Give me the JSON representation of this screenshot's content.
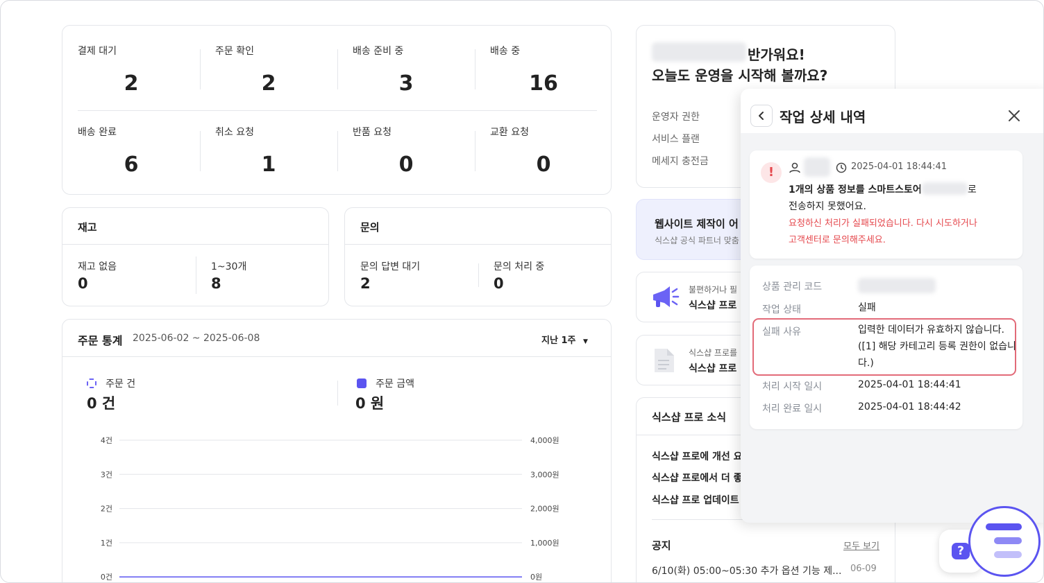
{
  "order_status": [
    {
      "label": "결제 대기",
      "value": "2"
    },
    {
      "label": "주문 확인",
      "value": "2"
    },
    {
      "label": "배송 준비 중",
      "value": "3"
    },
    {
      "label": "배송 중",
      "value": "16"
    },
    {
      "label": "배송 완료",
      "value": "6"
    },
    {
      "label": "취소 요청",
      "value": "1"
    },
    {
      "label": "반품 요청",
      "value": "0"
    },
    {
      "label": "교환 요청",
      "value": "0"
    }
  ],
  "inventory": {
    "title": "재고",
    "items": [
      {
        "label": "재고 없음",
        "value": "0"
      },
      {
        "label": "1~30개",
        "value": "8"
      }
    ]
  },
  "inquiry": {
    "title": "문의",
    "items": [
      {
        "label": "문의 답변 대기",
        "value": "2"
      },
      {
        "label": "문의 처리 중",
        "value": "0"
      }
    ]
  },
  "order_stats": {
    "title": "주문 통계",
    "date_range": "2025-06-02 ~ 2025-06-08",
    "period_select": "지난 1주",
    "legend_count_label": "주문 건",
    "legend_count_value": "0 건",
    "legend_amount_label": "주문 금액",
    "legend_amount_value": "0 원",
    "colors": {
      "count": "#6b63f5",
      "amount": "#5b54f0"
    }
  },
  "chart_data": {
    "type": "line",
    "left_ticks": [
      "4건",
      "3건",
      "2건",
      "1건",
      "0건"
    ],
    "right_ticks": [
      "4,000원",
      "3,000원",
      "2,000원",
      "1,000원",
      "0원"
    ],
    "ylim_count": [
      0,
      4
    ],
    "ylim_amount": [
      0,
      4000
    ],
    "series": [
      {
        "name": "주문 건",
        "values": [
          0,
          0,
          0,
          0,
          0,
          0,
          0
        ]
      },
      {
        "name": "주문 금액",
        "values": [
          0,
          0,
          0,
          0,
          0,
          0,
          0
        ]
      }
    ],
    "grid": true
  },
  "welcome": {
    "line1": "반가워요!",
    "line2": "오늘도 운영을 시작해 볼까요?",
    "rows": [
      "운영자 권한",
      "서비스 플랜",
      "메세지 충전금"
    ]
  },
  "promo": {
    "title": "웹사이트 제작이 어",
    "sub": "식스샵 공식 파트너 맞춤"
  },
  "feedback": {
    "sub": "불편하거나 필",
    "title": "식스샵 프로"
  },
  "guide": {
    "sub": "식스샵 프로를",
    "title": "식스샵 프로"
  },
  "news": {
    "title": "식스샵 프로 소식",
    "items": [
      "식스샵 프로에 개선 요",
      "식스샵 프로에서 더 좋",
      "식스샵 프로 업데이트"
    ]
  },
  "notice": {
    "title": "공지",
    "more": "모두 보기",
    "item_text": "6/10(화) 05:00~05:30 추가 옵션 기능 제...",
    "item_date": "06-09"
  },
  "panel": {
    "title": "작업 상세 내역",
    "timestamp": "2025-04-01 18:44:41",
    "msg_bold": "1개의 상품 정보를 스마트스토어",
    "msg_tail": "로",
    "msg_line2": "전송하지 못했어요.",
    "error_line1": "요청하신 처리가 실패되었습니다. 다시 시도하거나",
    "error_line2": "고객센터로 문의해주세요.",
    "details": {
      "product_code_label": "상품 관리 코드",
      "status_label": "작업 상태",
      "status_value": "실패",
      "reason_label": "실패 사유",
      "reason_line1": "입력한 데이터가 유효하지 않습니다.",
      "reason_line2": "([1] 해당 카테고리 등록 권한이 없습니",
      "reason_line3": "다.)",
      "start_label": "처리 시작 일시",
      "start_value": "2025-04-01 18:44:41",
      "end_label": "처리 완료 일시",
      "end_value": "2025-04-01 18:44:42"
    },
    "colors": {
      "error": "#e5484d",
      "highlight": "#e26a78"
    }
  },
  "help_button": {
    "glyph": "?"
  }
}
